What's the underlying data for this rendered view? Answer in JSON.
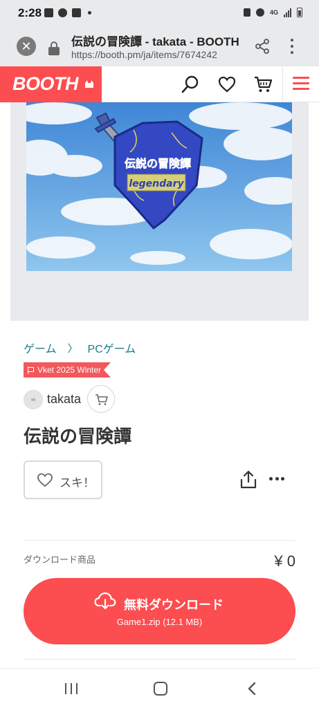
{
  "status_bar": {
    "time": "2:28",
    "network": "4G"
  },
  "browser": {
    "title": "伝説の冒険譚 - takata - BOOTH",
    "url": "https://booth.pm/ja/items/7674242"
  },
  "booth_header": {
    "logo": "BOOTH",
    "brand_color": "#fc4d50"
  },
  "hero": {
    "artwork_title": "伝説の冒険譚",
    "artwork_subtitle": "legendary"
  },
  "item": {
    "breadcrumb": [
      "ゲーム",
      "PCゲーム"
    ],
    "event_tag": "Vket 2025 Winter",
    "shop_name": "takata",
    "title": "伝説の冒険譚",
    "like_label": "スキ！",
    "download_section_label": "ダウンロード商品",
    "price": "¥ 0",
    "download_button_label": "無料ダウンロード",
    "download_file": "Game1.zip (12.1 MB)"
  },
  "icons": [
    "close-icon",
    "lock-icon",
    "share-icon",
    "kebab-menu-icon",
    "search-icon",
    "heart-icon",
    "cart-icon",
    "hamburger-menu-icon",
    "flag-icon",
    "cloud-download-icon",
    "more-dots-icon"
  ]
}
